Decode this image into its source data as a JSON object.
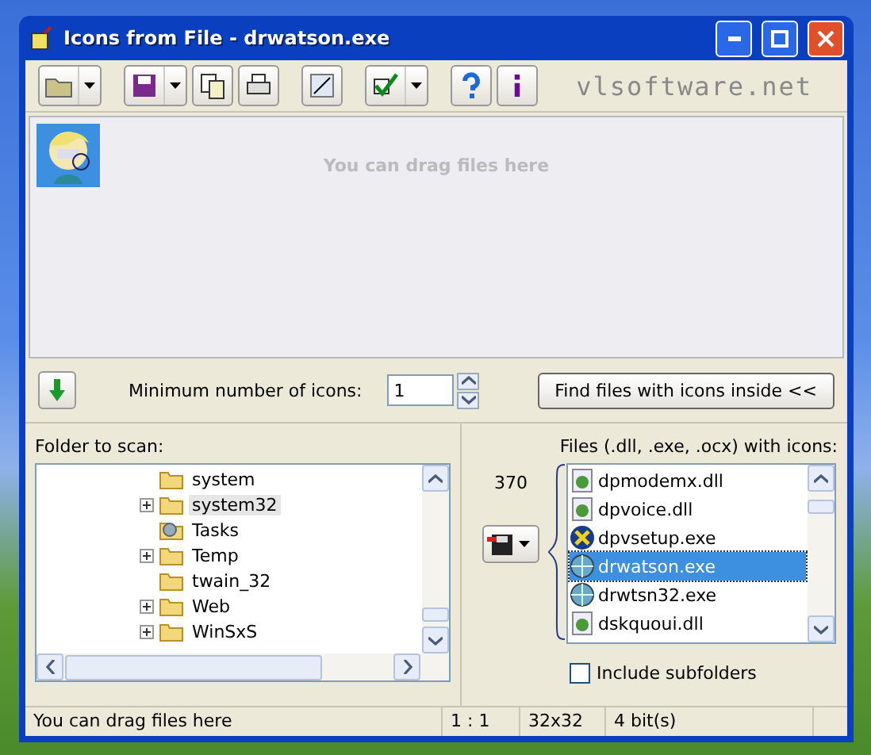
{
  "window": {
    "title": "Icons from File - drwatson.exe"
  },
  "toolbar": [
    {
      "kind": "open",
      "dropdown": true
    },
    {
      "kind": "save",
      "dropdown": true
    },
    {
      "kind": "copy",
      "dropdown": false
    },
    {
      "kind": "print",
      "dropdown": false
    },
    {
      "kind": "resize",
      "dropdown": false
    },
    {
      "kind": "check",
      "dropdown": true
    },
    {
      "kind": "help",
      "dropdown": false
    },
    {
      "kind": "info",
      "dropdown": false
    }
  ],
  "brand": "vlsoftware.net",
  "drop_area": {
    "hint": "You can drag files here",
    "icons": [
      {
        "kind": "picture",
        "selected": true
      }
    ]
  },
  "options": {
    "min_icons_label": "Minimum number of icons:",
    "min_icons_value": "1",
    "find_button": "Find files with icons inside <<"
  },
  "folder_pane": {
    "label": "Folder to scan:",
    "items": [
      {
        "name": "system",
        "expandable": false,
        "selected": false,
        "kind": "folder"
      },
      {
        "name": "system32",
        "expandable": true,
        "selected": true,
        "kind": "folder"
      },
      {
        "name": "Tasks",
        "expandable": false,
        "selected": false,
        "kind": "tasks"
      },
      {
        "name": "Temp",
        "expandable": true,
        "selected": false,
        "kind": "folder"
      },
      {
        "name": "twain_32",
        "expandable": false,
        "selected": false,
        "kind": "folder"
      },
      {
        "name": "Web",
        "expandable": true,
        "selected": false,
        "kind": "folder"
      },
      {
        "name": "WinSxS",
        "expandable": true,
        "selected": false,
        "kind": "folder"
      }
    ]
  },
  "files_pane": {
    "label": "Files (.dll, .exe, .ocx) with icons:",
    "count": "370",
    "files": [
      {
        "name": "dpmodemx.dll",
        "selected": false,
        "kind": "dll"
      },
      {
        "name": "dpvoice.dll",
        "selected": false,
        "kind": "dll"
      },
      {
        "name": "dpvsetup.exe",
        "selected": false,
        "kind": "setup"
      },
      {
        "name": "drwatson.exe",
        "selected": true,
        "kind": "globe"
      },
      {
        "name": "drwtsn32.exe",
        "selected": false,
        "kind": "globe"
      },
      {
        "name": "dskquoui.dll",
        "selected": false,
        "kind": "dll"
      }
    ],
    "include_subfolders": {
      "label": "Include subfolders",
      "checked": false
    }
  },
  "status_bar": [
    "You can drag files here",
    "1 : 1",
    "32x32",
    "4 bit(s)"
  ]
}
